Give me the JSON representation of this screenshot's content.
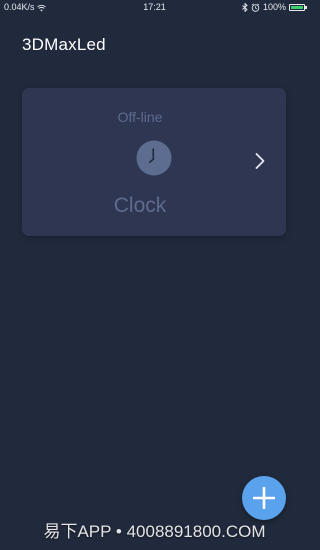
{
  "status_bar": {
    "network_speed": "0.04K/s",
    "time": "17:21",
    "battery_percent": "100%",
    "battery_level": 1.0,
    "icons": [
      "wifi-icon",
      "bluetooth-icon",
      "alarm-icon",
      "battery-icon"
    ]
  },
  "app": {
    "title": "3DMaxLed"
  },
  "devices": [
    {
      "status": "Off-line",
      "name": "Clock",
      "icon": "clock-icon"
    }
  ],
  "fab": {
    "icon": "plus-icon"
  },
  "watermark": {
    "text": "易下APP • 4008891800.COM"
  },
  "colors": {
    "background": "#212a3c",
    "card": "#2e3652",
    "muted_text": "#5e6b8e",
    "fab": "#5aa3ec",
    "battery": "#3bd16f"
  }
}
